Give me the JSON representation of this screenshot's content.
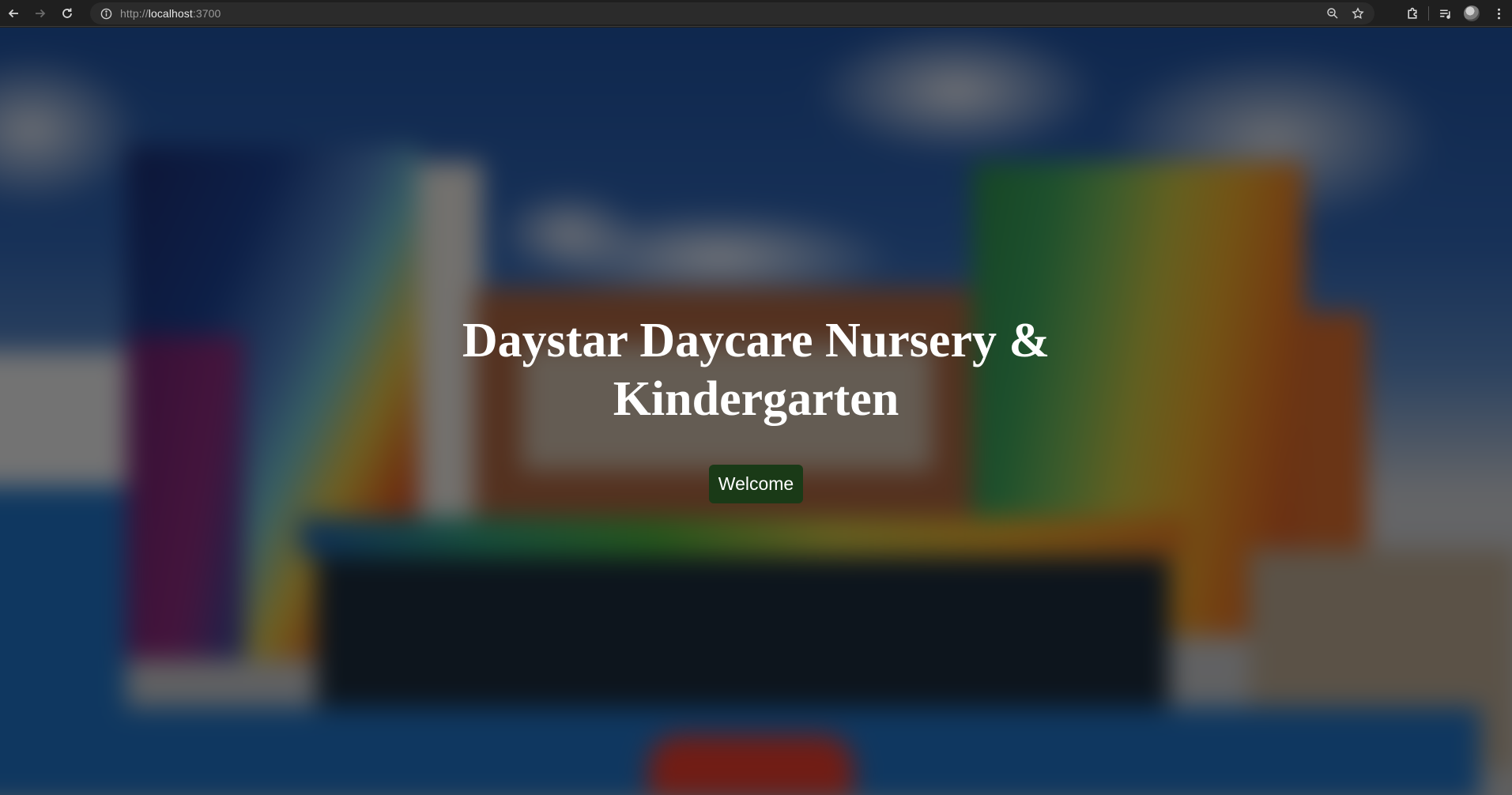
{
  "browser": {
    "url_scheme": "http://",
    "url_host": "localhost",
    "url_port": ":3700",
    "icons": {
      "back": "back-arrow-icon",
      "forward": "forward-arrow-icon",
      "reload": "reload-icon",
      "site_info": "info-icon",
      "zoom": "zoom-icon",
      "bookmark": "star-icon",
      "extensions": "puzzle-icon",
      "media": "media-queue-icon",
      "profile": "avatar",
      "menu": "kebab-menu-icon"
    }
  },
  "page": {
    "title": "Daystar Daycare Nursery & Kindergarten",
    "welcome_label": "Welcome",
    "colors": {
      "overlay": "#000000",
      "button_bg": "#1a3a17",
      "text": "#ffffff"
    }
  }
}
